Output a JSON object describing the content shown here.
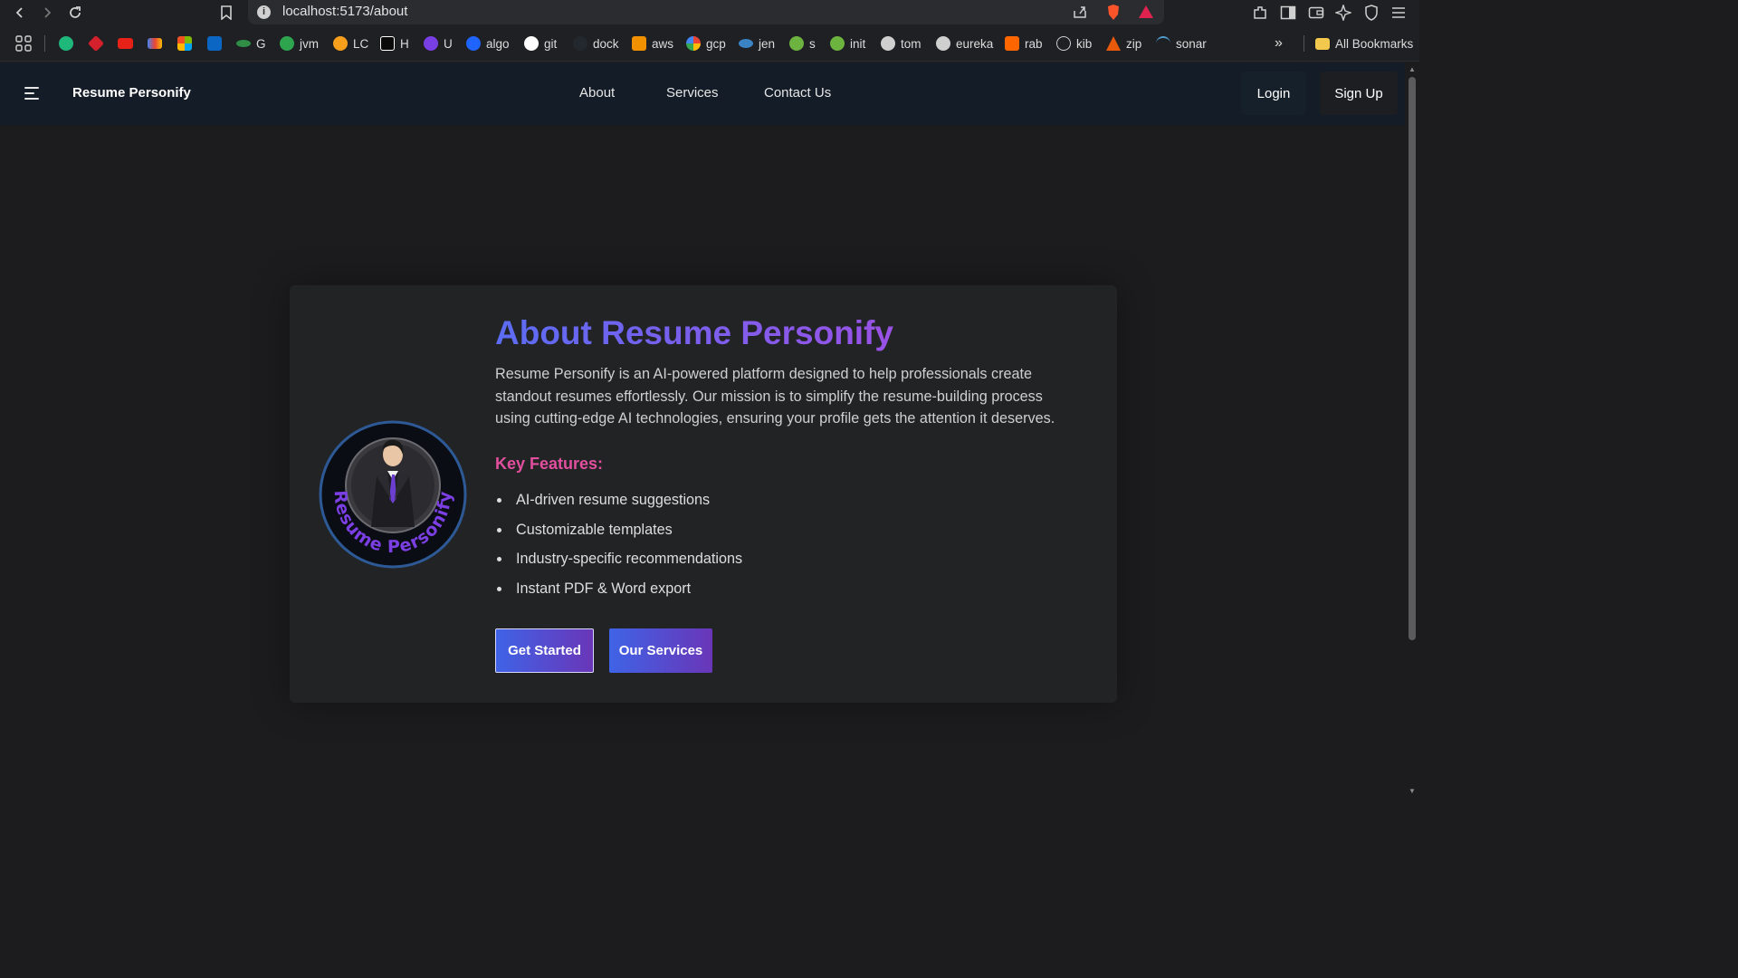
{
  "browser": {
    "url": "localhost:5173/about",
    "bookmarks": [
      {
        "label": "",
        "color": "#1fb87b"
      },
      {
        "label": "",
        "color": "#d3202a"
      },
      {
        "label": "",
        "color": "#e62117"
      },
      {
        "label": "",
        "color": "#ea4335"
      },
      {
        "label": "",
        "color": "#f25022"
      },
      {
        "label": "",
        "color": "#0a66c2"
      },
      {
        "label": "G",
        "color": "#2f8d46"
      },
      {
        "label": "jvm",
        "color": "#2ea44f"
      },
      {
        "label": "LC",
        "color": "#f89f1b"
      },
      {
        "label": "H",
        "color": "#2d2d2d"
      },
      {
        "label": "U",
        "color": "#7a3fe4"
      },
      {
        "label": "algo",
        "color": "#1f64ff"
      },
      {
        "label": "git",
        "color": "#ffffff"
      },
      {
        "label": "dock",
        "color": "#2b2c30"
      },
      {
        "label": "aws",
        "color": "#f29100"
      },
      {
        "label": "gcp",
        "color": "#ffffff"
      },
      {
        "label": "jen",
        "color": "#3a83c4"
      },
      {
        "label": "s",
        "color": "#6db33f"
      },
      {
        "label": "init",
        "color": "#6db33f"
      },
      {
        "label": "tom",
        "color": "#cfcfcf"
      },
      {
        "label": "eureka",
        "color": "#cfcfcf"
      },
      {
        "label": "rab",
        "color": "#ff6600"
      },
      {
        "label": "kib",
        "color": "#cfcfcf"
      },
      {
        "label": "zip",
        "color": "#e8590c"
      },
      {
        "label": "sonar",
        "color": "#4e9bcd"
      }
    ],
    "all_bookmarks_label": "All Bookmarks"
  },
  "navbar": {
    "brand": "Resume Personify",
    "links": [
      "About",
      "Services",
      "Contact Us"
    ],
    "login_label": "Login",
    "signup_label": "Sign Up"
  },
  "about": {
    "title": "About Resume Personify",
    "description": "Resume Personify is an AI-powered platform designed to help professionals create standout resumes effortlessly. Our mission is to simplify the resume-building process using cutting-edge AI technologies, ensuring your profile gets the attention it deserves.",
    "features_title": "Key Features:",
    "features": [
      "AI-driven resume suggestions",
      "Customizable templates",
      "Industry-specific recommendations",
      "Instant PDF & Word export"
    ],
    "get_started_label": "Get Started",
    "our_services_label": "Our Services",
    "logo_text": "Resume Personify"
  },
  "colors": {
    "page_bg": "#1c1c1e",
    "navbar_bg": "#141c27",
    "card_bg": "#222325",
    "accent_pink": "#e24f9f",
    "title_gradient_start": "#5b6cf3",
    "title_gradient_end": "#9a52e6"
  }
}
